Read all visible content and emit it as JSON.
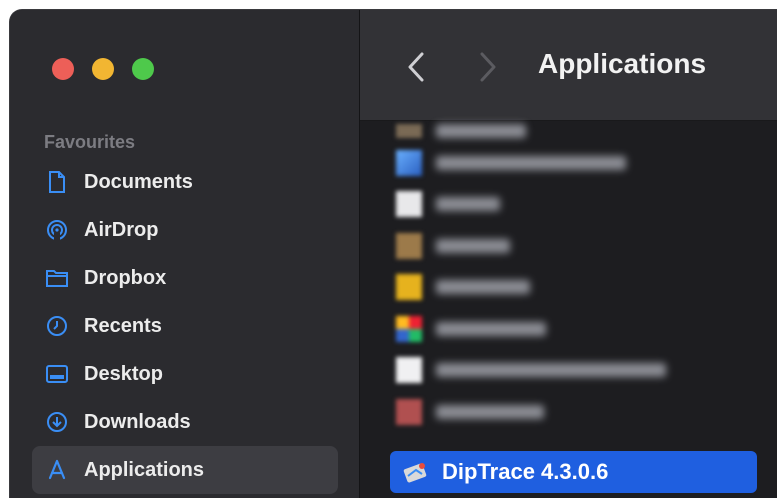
{
  "sidebar": {
    "section_title": "Favourites",
    "items": [
      {
        "label": "Documents",
        "icon": "document-icon"
      },
      {
        "label": "AirDrop",
        "icon": "airdrop-icon"
      },
      {
        "label": "Dropbox",
        "icon": "folder-icon"
      },
      {
        "label": "Recents",
        "icon": "clock-icon"
      },
      {
        "label": "Desktop",
        "icon": "desktop-icon"
      },
      {
        "label": "Downloads",
        "icon": "download-icon"
      },
      {
        "label": "Applications",
        "icon": "applications-icon"
      }
    ],
    "active_index": 6
  },
  "toolbar": {
    "title": "Applications"
  },
  "files": {
    "selected": {
      "name": "DipTrace 4.3.0.6",
      "icon": "diptrace-app-icon"
    }
  },
  "colors": {
    "accent": "#1f5fe0",
    "icon_blue": "#3a8ef5",
    "close": "#ed5f58",
    "minimize": "#f2b632",
    "zoom": "#4ec94b"
  }
}
